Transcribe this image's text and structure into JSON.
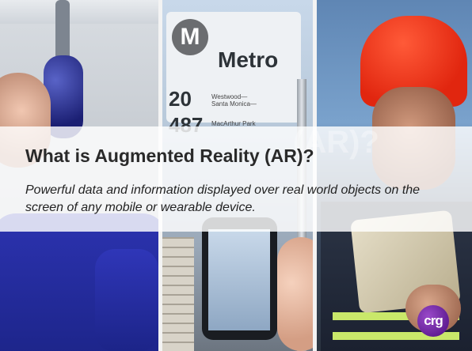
{
  "slide": {
    "title": "What is Augmented Reality (AR)?",
    "subtitle": "Powerful data and information displayed over real world objects on the screen of any mobile or wearable device.",
    "title_echo": "(AR)?"
  },
  "photos": [
    {
      "subject": "worker-with-tool"
    },
    {
      "subject": "metro-bus-sign-with-phone"
    },
    {
      "subject": "worker-with-hardhat-and-tablet"
    }
  ],
  "metro_sign": {
    "brand_letter": "M",
    "brand_name": "Metro",
    "route_1": "20",
    "route_1_text": "Westwood—\nSanta Monica—",
    "route_2": "487",
    "route_2_text": "MacArthur Park"
  },
  "logo": {
    "text": "crg"
  },
  "colors": {
    "band": "#ffffff",
    "title": "#2a2a2a",
    "logo": "#6a2aa0",
    "helmet": "#e1260f",
    "shirt": "#2c33b0"
  }
}
